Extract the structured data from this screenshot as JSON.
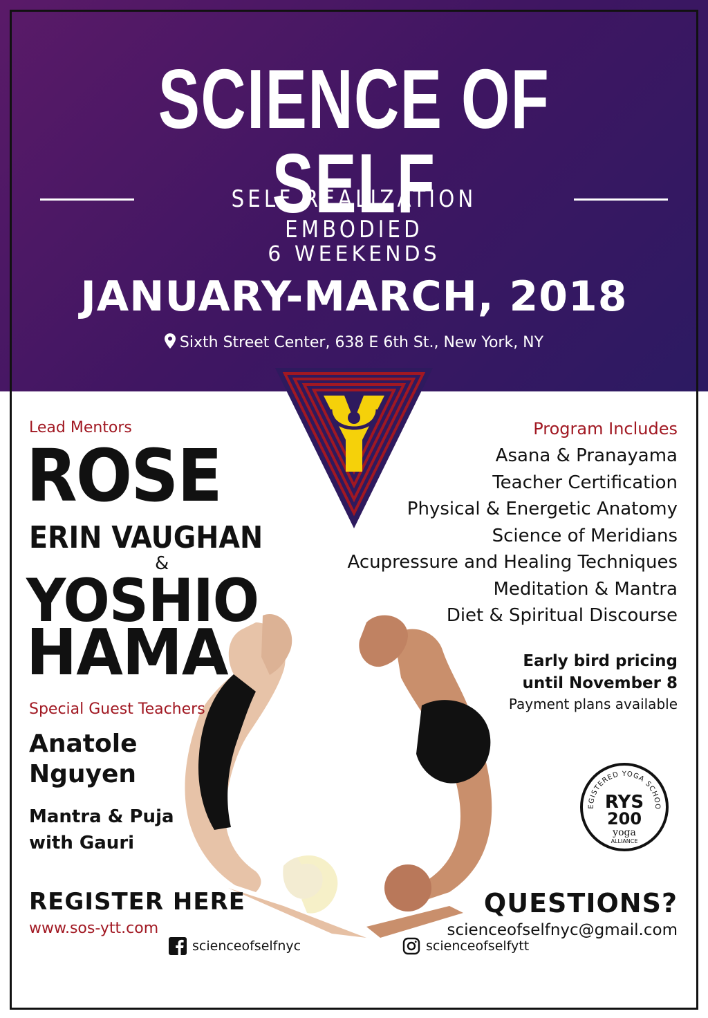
{
  "header": {
    "title": "SCIENCE OF SELF",
    "subtitle": "SELF REALIZATION EMBODIED",
    "weeks": "6 WEEKENDS",
    "dates": "JANUARY-MARCH, 2018",
    "location": "Sixth Street Center, 638 E 6th St., New York, NY",
    "colors": {
      "purple_left": "#5a1a68",
      "purple_right": "#2c1a62",
      "accent_red": "#a11822",
      "logo_yellow": "#f5d10a"
    }
  },
  "mentors": {
    "label": "Lead Mentors",
    "name1_first": "ROSE",
    "name1_rest": "ERIN VAUGHAN",
    "ampersand": "&",
    "name2_first": "YOSHIO",
    "name2_last": "HAMA"
  },
  "guests": {
    "label": "Special Guest Teachers",
    "guest1": "Anatole Nguyen",
    "guest2": "Mantra & Puja with Gauri"
  },
  "program": {
    "label": "Program Includes",
    "items": [
      "Asana & Pranayama",
      "Teacher Certification",
      "Physical & Energetic Anatomy",
      "Science of Meridians",
      "Acupressure and Healing Techniques",
      "Meditation & Mantra",
      "Diet & Spiritual Discourse"
    ]
  },
  "pricing": {
    "early_line1": "Early bird pricing",
    "early_line2": "until November 8",
    "payment": "Payment plans available"
  },
  "badge": {
    "top_arc": "REGISTERED YOGA SCHOOL",
    "code": "RYS",
    "hours": "200",
    "org": "yoga",
    "org_sub": "ALLIANCE"
  },
  "register": {
    "label": "REGISTER HERE",
    "url": "www.sos-ytt.com"
  },
  "contact": {
    "label": "QUESTIONS?",
    "email": "scienceofselfnyc@gmail.com"
  },
  "social": {
    "facebook_icon": "facebook-icon",
    "facebook": "scienceofselfnyc",
    "instagram_icon": "instagram-icon",
    "instagram": "scienceofselfytt"
  }
}
